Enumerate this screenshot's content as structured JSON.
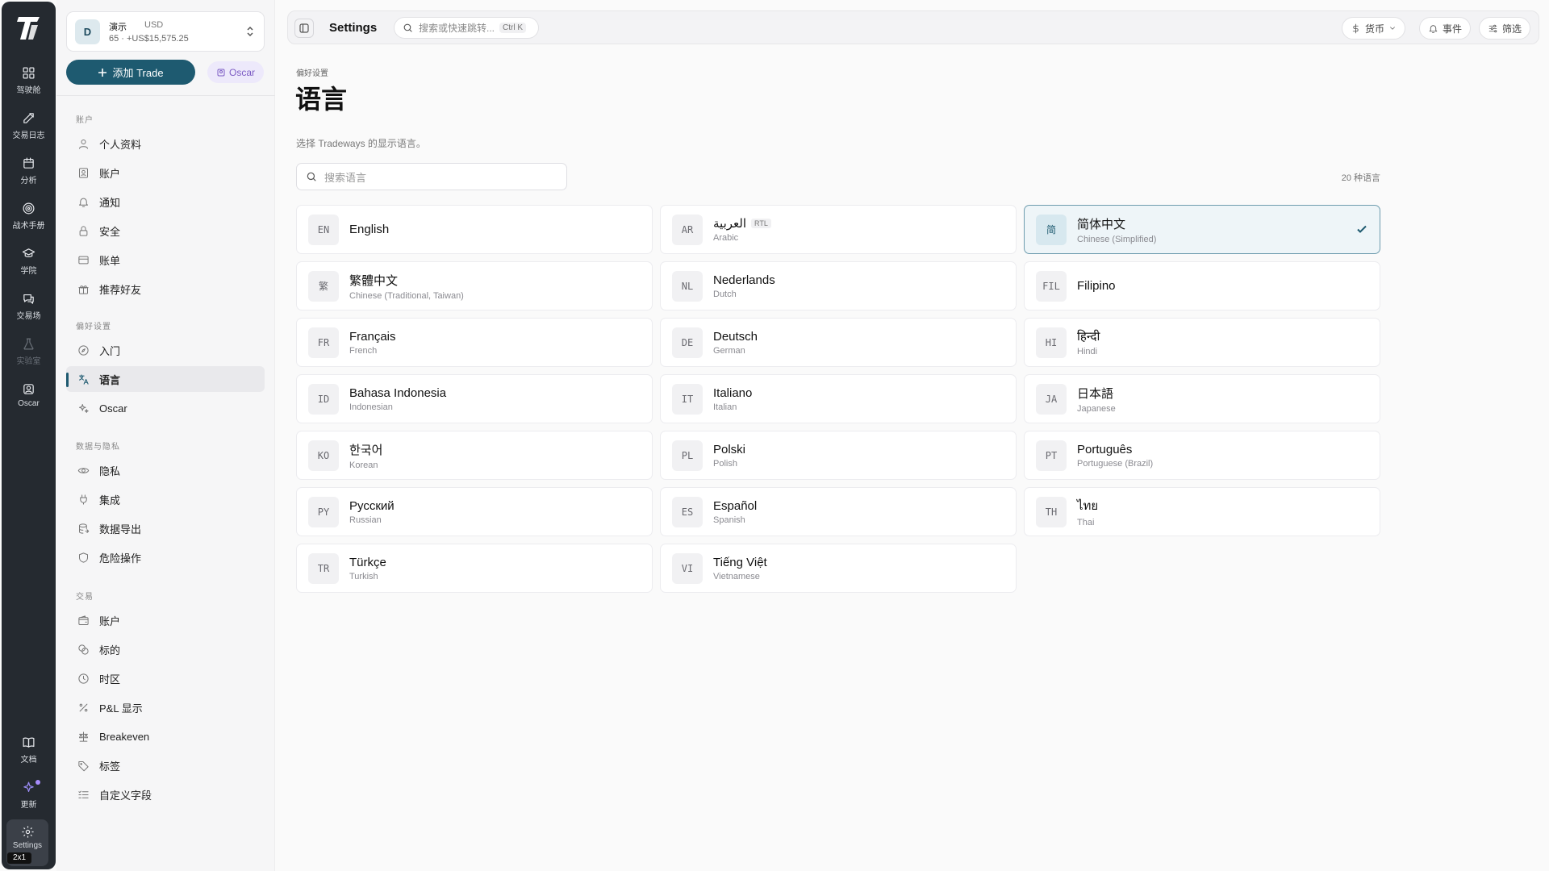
{
  "rail": {
    "items": [
      {
        "label": "驾驶舱",
        "icon": "dashboard-icon"
      },
      {
        "label": "交易日志",
        "icon": "journal-icon"
      },
      {
        "label": "分析",
        "icon": "calendar-icon"
      },
      {
        "label": "战术手册",
        "icon": "target-icon"
      },
      {
        "label": "学院",
        "icon": "graduation-cap-icon"
      },
      {
        "label": "交易场",
        "icon": "chat-icon"
      },
      {
        "label": "实验室",
        "icon": "flask-icon"
      },
      {
        "label": "Oscar",
        "icon": "oscar-icon"
      }
    ],
    "bottom": [
      {
        "label": "文档",
        "icon": "book-icon"
      },
      {
        "label": "更新",
        "icon": "sparkle-icon"
      }
    ],
    "settings_label": "Settings",
    "badge": "2x1"
  },
  "account": {
    "avatar": "D",
    "name": "演示",
    "currency": "USD",
    "summary": "65 · +US$15,575.25"
  },
  "actions": {
    "add_trade": "添加 Trade",
    "oscar": "Oscar"
  },
  "sidebar": {
    "sections": [
      {
        "title": "账户",
        "items": [
          "个人资料",
          "账户",
          "通知",
          "安全",
          "账单",
          "推荐好友"
        ]
      },
      {
        "title": "偏好设置",
        "items": [
          "入门",
          "语言",
          "Oscar"
        ]
      },
      {
        "title": "数据与隐私",
        "items": [
          "隐私",
          "集成",
          "数据导出",
          "危险操作"
        ]
      },
      {
        "title": "交易",
        "items": [
          "账户",
          "标的",
          "时区",
          "P&L 显示",
          "Breakeven",
          "标签",
          "自定义字段"
        ]
      }
    ],
    "active": "语言"
  },
  "topbar": {
    "title": "Settings",
    "search_placeholder": "搜索或快速跳转...",
    "search_shortcut": "Ctrl K",
    "currency_label": "货币",
    "events_label": "事件",
    "filter_label": "筛选"
  },
  "page": {
    "breadcrumb": "偏好设置",
    "title": "语言",
    "description": "选择 Tradeways 的显示语言。",
    "search_placeholder": "搜索语言",
    "count": "20 种语言"
  },
  "languages": [
    {
      "code": "EN",
      "native": "English",
      "english": ""
    },
    {
      "code": "AR",
      "native": "العربية",
      "english": "Arabic",
      "tag": "RTL"
    },
    {
      "code": "简",
      "native": "简体中文",
      "english": "Chinese (Simplified)",
      "selected": true
    },
    {
      "code": "繁",
      "native": "繁體中文",
      "english": "Chinese (Traditional, Taiwan)"
    },
    {
      "code": "NL",
      "native": "Nederlands",
      "english": "Dutch"
    },
    {
      "code": "FIL",
      "native": "Filipino",
      "english": ""
    },
    {
      "code": "FR",
      "native": "Français",
      "english": "French"
    },
    {
      "code": "DE",
      "native": "Deutsch",
      "english": "German"
    },
    {
      "code": "HI",
      "native": "हिन्दी",
      "english": "Hindi"
    },
    {
      "code": "ID",
      "native": "Bahasa Indonesia",
      "english": "Indonesian"
    },
    {
      "code": "IT",
      "native": "Italiano",
      "english": "Italian"
    },
    {
      "code": "JA",
      "native": "日本語",
      "english": "Japanese"
    },
    {
      "code": "KO",
      "native": "한국어",
      "english": "Korean"
    },
    {
      "code": "PL",
      "native": "Polski",
      "english": "Polish"
    },
    {
      "code": "PT",
      "native": "Português",
      "english": "Portuguese (Brazil)"
    },
    {
      "code": "PY",
      "native": "Русский",
      "english": "Russian"
    },
    {
      "code": "ES",
      "native": "Español",
      "english": "Spanish"
    },
    {
      "code": "TH",
      "native": "ไทย",
      "english": "Thai"
    },
    {
      "code": "TR",
      "native": "Türkçe",
      "english": "Turkish"
    },
    {
      "code": "VI",
      "native": "Tiếng Việt",
      "english": "Vietnamese"
    }
  ],
  "colors": {
    "accent": "#1e5a70",
    "rail_bg": "#252a30",
    "selected_bg": "#eef5f8",
    "oscar_purple": "#7c5cc4"
  }
}
